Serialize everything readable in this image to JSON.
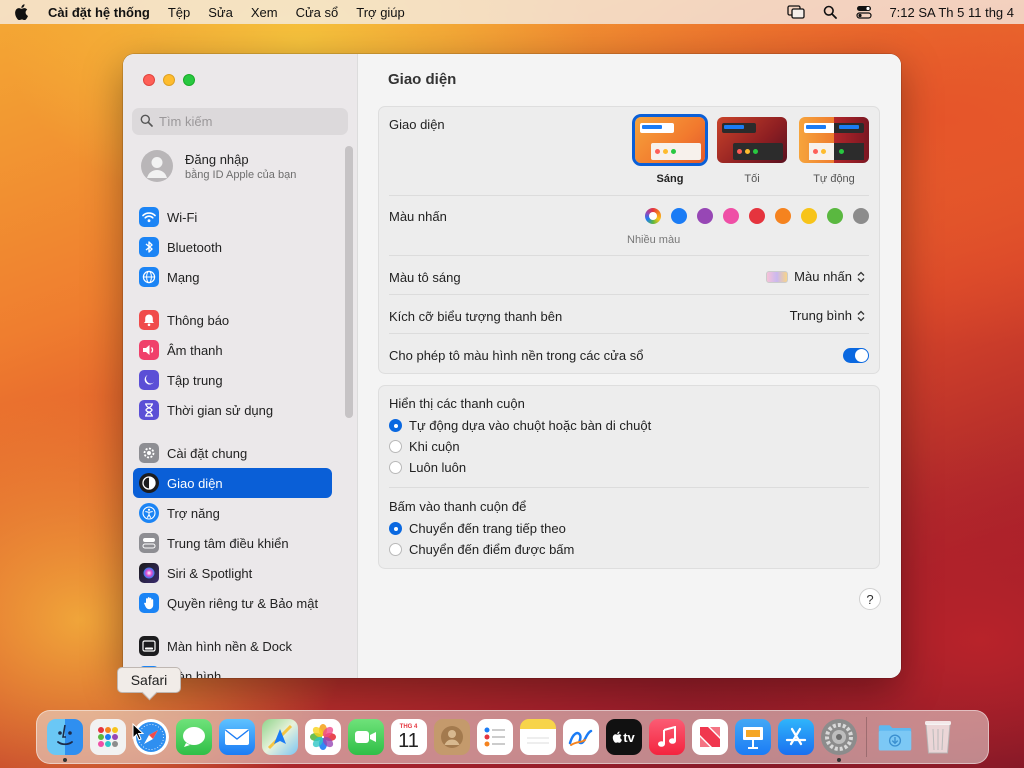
{
  "menubar": {
    "app_name": "Cài đặt hệ thống",
    "menus": [
      "Tệp",
      "Sửa",
      "Xem",
      "Cửa sổ",
      "Trợ giúp"
    ],
    "clock": "7:12 SA Th 5 11 thg 4"
  },
  "sidebar": {
    "search_placeholder": "Tìm kiếm",
    "login_title": "Đăng nhập",
    "login_subtitle": "bằng ID Apple của bạn",
    "items": [
      {
        "label": "Wi-Fi",
        "icon": "wifi-icon",
        "color": "#1b84f5"
      },
      {
        "label": "Bluetooth",
        "icon": "bluetooth-icon",
        "color": "#1b84f5"
      },
      {
        "label": "Mạng",
        "icon": "globe-icon",
        "color": "#1b84f5"
      },
      {
        "label": "Thông báo",
        "icon": "bell-icon",
        "color": "#f04b4b"
      },
      {
        "label": "Âm thanh",
        "icon": "speaker-icon",
        "color": "#f0406b"
      },
      {
        "label": "Tập trung",
        "icon": "moon-icon",
        "color": "#5b4fd6"
      },
      {
        "label": "Thời gian sử dụng",
        "icon": "hourglass-icon",
        "color": "#5b4fd6"
      },
      {
        "label": "Cài đặt chung",
        "icon": "gear-icon",
        "color": "#8e8e93"
      },
      {
        "label": "Giao diện",
        "icon": "appearance-icon",
        "color": "#1c1c1e"
      },
      {
        "label": "Trợ năng",
        "icon": "accessibility-icon",
        "color": "#1b84f5"
      },
      {
        "label": "Trung tâm điều khiển",
        "icon": "control-center-icon",
        "color": "#8e8e93"
      },
      {
        "label": "Siri & Spotlight",
        "icon": "siri-icon",
        "color": "#7b3fe4"
      },
      {
        "label": "Quyền riêng tư & Bảo mật",
        "icon": "hand-icon",
        "color": "#1b84f5"
      },
      {
        "label": "Màn hình nền & Dock",
        "icon": "dock-icon",
        "color": "#1c1c1e"
      },
      {
        "label": "Màn hình",
        "icon": "display-icon",
        "color": "#1b84f5"
      }
    ]
  },
  "content": {
    "title": "Giao diện",
    "appearance_label": "Giao diện",
    "appearance_options": [
      "Sáng",
      "Tối",
      "Tự động"
    ],
    "accent_label": "Màu nhấn",
    "accent_colors": [
      "#ffffff",
      "#1b7cf5",
      "#9747b5",
      "#ef4fa6",
      "#e5343e",
      "#f5831f",
      "#f7c41a",
      "#5ab840",
      "#8c8c8c"
    ],
    "accent_multi_label": "Nhiều màu",
    "highlight_label": "Màu tô sáng",
    "highlight_value": "Màu nhấn",
    "sidebar_size_label": "Kích cỡ biểu tượng thanh bên",
    "sidebar_size_value": "Trung bình",
    "tinting_label": "Cho phép tô màu hình nền trong các cửa sổ",
    "tinting_enabled": true,
    "scrollbars_label": "Hiển thị các thanh cuộn",
    "scroll_options": [
      "Tự động dựa vào chuột hoặc bàn di chuột",
      "Khi cuộn",
      "Luôn luôn"
    ],
    "click_label": "Bấm vào thanh cuộn để",
    "click_options": [
      "Chuyển đến trang tiếp theo",
      "Chuyển đến điểm được bấm"
    ],
    "help": "?"
  },
  "dock": {
    "tooltip": "Safari",
    "calendar_month": "THG 4",
    "calendar_day": "11",
    "tv_label": "tv"
  }
}
